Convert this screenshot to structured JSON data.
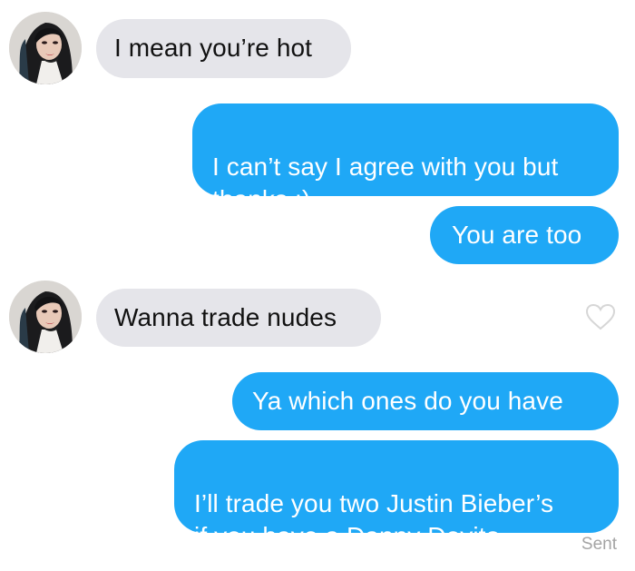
{
  "conversation": {
    "messages": [
      {
        "sender": "them",
        "text": "I mean you’re hot"
      },
      {
        "sender": "me",
        "text": "I can’t say I agree with you but\nthanks :)"
      },
      {
        "sender": "me",
        "text": "You are too"
      },
      {
        "sender": "them",
        "text": "Wanna trade nudes"
      },
      {
        "sender": "me",
        "text": "Ya which ones do you have"
      },
      {
        "sender": "me",
        "text": "I’ll trade you two Justin Bieber’s\nif you have a Danny Devito"
      }
    ],
    "status": "Sent"
  },
  "colors": {
    "outgoing_bubble": "#1fa8f6",
    "incoming_bubble": "#e5e5ea",
    "status_text": "#a4a4a4"
  },
  "icons": {
    "like": "heart-outline-icon"
  }
}
